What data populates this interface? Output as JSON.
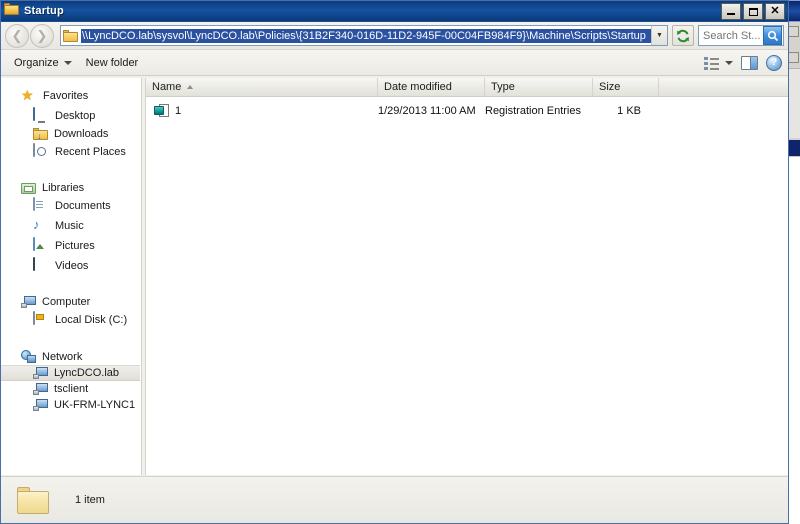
{
  "window": {
    "title": "Startup",
    "icon": "folder-icon",
    "controls": {
      "minimize": "_",
      "maximize": "□",
      "close": "✕"
    }
  },
  "navbar": {
    "back_label": "◄",
    "forward_label": "►",
    "address_value": "\\\\LyncDCO.lab\\sysvol\\LyncDCO.lab\\Policies\\{31B2F340-016D-11D2-945F-00C04FB984F9}\\Machine\\Scripts\\Startup",
    "address_dropdown": "▼",
    "refresh_icon": "refresh-icon",
    "search_placeholder": "Search St...",
    "search_value": "",
    "search_icon": "magnifier-icon"
  },
  "commandbar": {
    "organize_label": "Organize",
    "new_folder_label": "New folder",
    "view_icon": "view-list-icon",
    "view_caret": "▼",
    "preview_pane_icon": "preview-pane-icon",
    "help_icon": "help-icon",
    "help_glyph": "?"
  },
  "navpane": {
    "groups": [
      {
        "root": {
          "label": "Favorites",
          "icon": "star-icon"
        },
        "children": [
          {
            "label": "Desktop",
            "icon": "desktop-icon",
            "selected": false
          },
          {
            "label": "Downloads",
            "icon": "downloads-folder-icon",
            "selected": false
          },
          {
            "label": "Recent Places",
            "icon": "recent-places-icon",
            "selected": false
          }
        ]
      },
      {
        "root": {
          "label": "Libraries",
          "icon": "libraries-icon"
        },
        "children": [
          {
            "label": "Documents",
            "icon": "document-icon",
            "selected": false
          },
          {
            "label": "Music",
            "icon": "music-note-icon",
            "selected": false
          },
          {
            "label": "Pictures",
            "icon": "picture-icon",
            "selected": false
          },
          {
            "label": "Videos",
            "icon": "video-icon",
            "selected": false
          }
        ]
      },
      {
        "root": {
          "label": "Computer",
          "icon": "computer-icon"
        },
        "children": [
          {
            "label": "Local Disk (C:)",
            "icon": "hard-disk-icon",
            "selected": false
          }
        ]
      },
      {
        "root": {
          "label": "Network",
          "icon": "network-icon"
        },
        "children": [
          {
            "label": "LyncDCO.lab",
            "icon": "network-computer-icon",
            "selected": true
          },
          {
            "label": "tsclient",
            "icon": "network-computer-icon",
            "selected": false
          },
          {
            "label": "UK-FRM-LYNC1",
            "icon": "network-computer-icon",
            "selected": false
          }
        ]
      }
    ]
  },
  "filelist": {
    "columns": [
      {
        "key": "name",
        "label": "Name",
        "sorted": true,
        "sort_caret": "▲"
      },
      {
        "key": "date",
        "label": "Date modified",
        "sorted": false
      },
      {
        "key": "type",
        "label": "Type",
        "sorted": false
      },
      {
        "key": "size",
        "label": "Size",
        "sorted": false
      }
    ],
    "rows": [
      {
        "icon": "registration-entries-icon",
        "name": "1",
        "date": "1/29/2013 11:00 AM",
        "type": "Registration Entries",
        "size": "1 KB"
      }
    ]
  },
  "statusbar": {
    "icon": "folder-icon",
    "text": "1 item"
  },
  "colors": {
    "titlebar_start": "#0a3d7d",
    "titlebar_end": "#0b3b79",
    "selection_blue": "#2a52a0",
    "chrome_bg": "#f0efe9",
    "list_bg": "#ffffff"
  }
}
